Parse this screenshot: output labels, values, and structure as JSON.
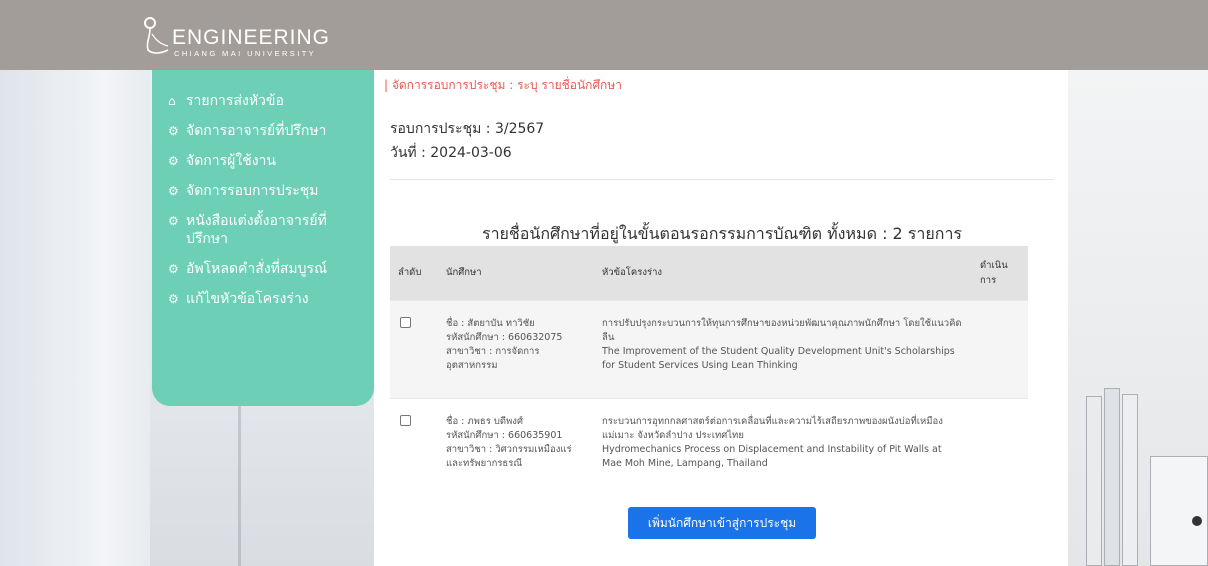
{
  "header": {
    "logo_title": "ENGINEERING",
    "logo_subtitle": "CHIANG MAI UNIVERSITY",
    "bg_color": "#a39d99"
  },
  "sidebar": {
    "bg_color": "#6dcfb5",
    "items": [
      {
        "label": "รายการส่งหัวข้อ",
        "icon": "home-icon"
      },
      {
        "label": "จัดการอาจารย์ที่ปรึกษา",
        "icon": "gear-icon"
      },
      {
        "label": "จัดการผู้ใช้งาน",
        "icon": "gear-icon"
      },
      {
        "label": "จัดการรอบการประชุม",
        "icon": "gear-icon"
      },
      {
        "label": "หนังสือแต่งตั้งอาจารย์ที่ปรึกษา",
        "icon": "gear-icon"
      },
      {
        "label": "อัพโหลดคำสั่งที่สมบูรณ์",
        "icon": "gear-icon"
      },
      {
        "label": "แก้ไขหัวข้อโครงร่าง",
        "icon": "gear-icon"
      }
    ]
  },
  "main": {
    "breadcrumb": "| จัดการรอบการประชุม : ระบุ รายชื่อนักศึกษา",
    "meeting_round": "รอบการประชุม : 3/2567",
    "meeting_date": "วันที่ : 2024-03-06",
    "list_title": "รายชื่อนักศึกษาที่อยู่ในขั้นตอนรอกรรมการบัณฑิต ทั้งหมด : 2 รายการ",
    "table": {
      "headers": {
        "no": "ลำดับ",
        "student": "นักศึกษา",
        "topic": "หัวข้อโครงร่าง",
        "action": "ดำเนินการ"
      },
      "rows": [
        {
          "name": "ชื่อ : สัตยาบัน ทาวิชัย",
          "student_id": "รหัสนักศึกษา : 660632075",
          "major": "สาขาวิชา : การจัดการอุตสาหกรรม",
          "topic_th": "การปรับปรุงกระบวนการให้ทุนการศึกษาของหน่วยพัฒนาคุณภาพนักศึกษา โดยใช้แนวคิดลีน",
          "topic_en": "The Improvement of the Student Quality Development Unit's Scholarships for Student Services Using Lean Thinking"
        },
        {
          "name": "ชื่อ : ภพธร บดีพงศ์",
          "student_id": "รหัสนักศึกษา : 660635901",
          "major": "สาขาวิชา : วิศวกรรมเหมืองแร่และทรัพยากรธรณี",
          "topic_th": "กระบวนการอุทกกลศาสตร์ต่อการเคลื่อนที่และความไร้เสถียรภาพของผนังบ่อที่เหมืองแม่เมาะ จังหวัดลำปาง ประเทศไทย",
          "topic_en": "Hydromechanics Process on Displacement and Instability of Pit Walls at Mae Moh Mine, Lampang, Thailand"
        }
      ]
    },
    "add_button_label": "เพิ่มนักศึกษาเข้าสู่การประชุม",
    "add_button_color": "#1a73e8",
    "breadcrumb_color": "#e85a4f"
  }
}
